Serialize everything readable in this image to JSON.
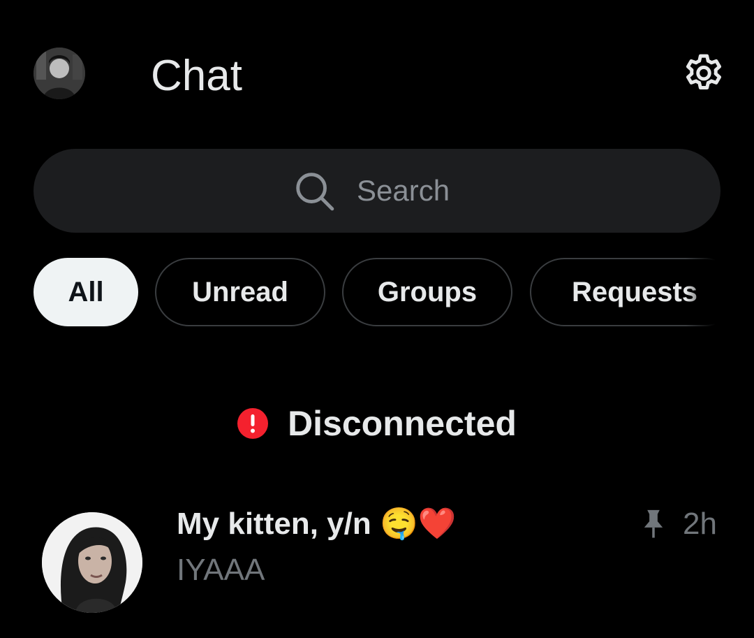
{
  "header": {
    "title": "Chat",
    "avatar_icon": "user-avatar",
    "settings_icon": "gear-icon"
  },
  "search": {
    "placeholder": "Search",
    "icon": "search-icon"
  },
  "filters": [
    {
      "label": "All",
      "active": true
    },
    {
      "label": "Unread",
      "active": false
    },
    {
      "label": "Groups",
      "active": false
    },
    {
      "label": "Requests",
      "active": false
    }
  ],
  "status": {
    "text": "Disconnected",
    "icon": "alert-icon",
    "color": "#f4212e"
  },
  "conversations": [
    {
      "name": "My kitten, y/n 🤤❤️",
      "preview": "IYAAA",
      "time": "2h",
      "pinned": true,
      "pin_icon": "pin-icon"
    }
  ],
  "colors": {
    "background": "#000000",
    "text_primary": "#e7e9ea",
    "text_secondary": "#71767b",
    "chip_active_bg": "#eff3f4",
    "search_bg": "#1c1d1f"
  }
}
